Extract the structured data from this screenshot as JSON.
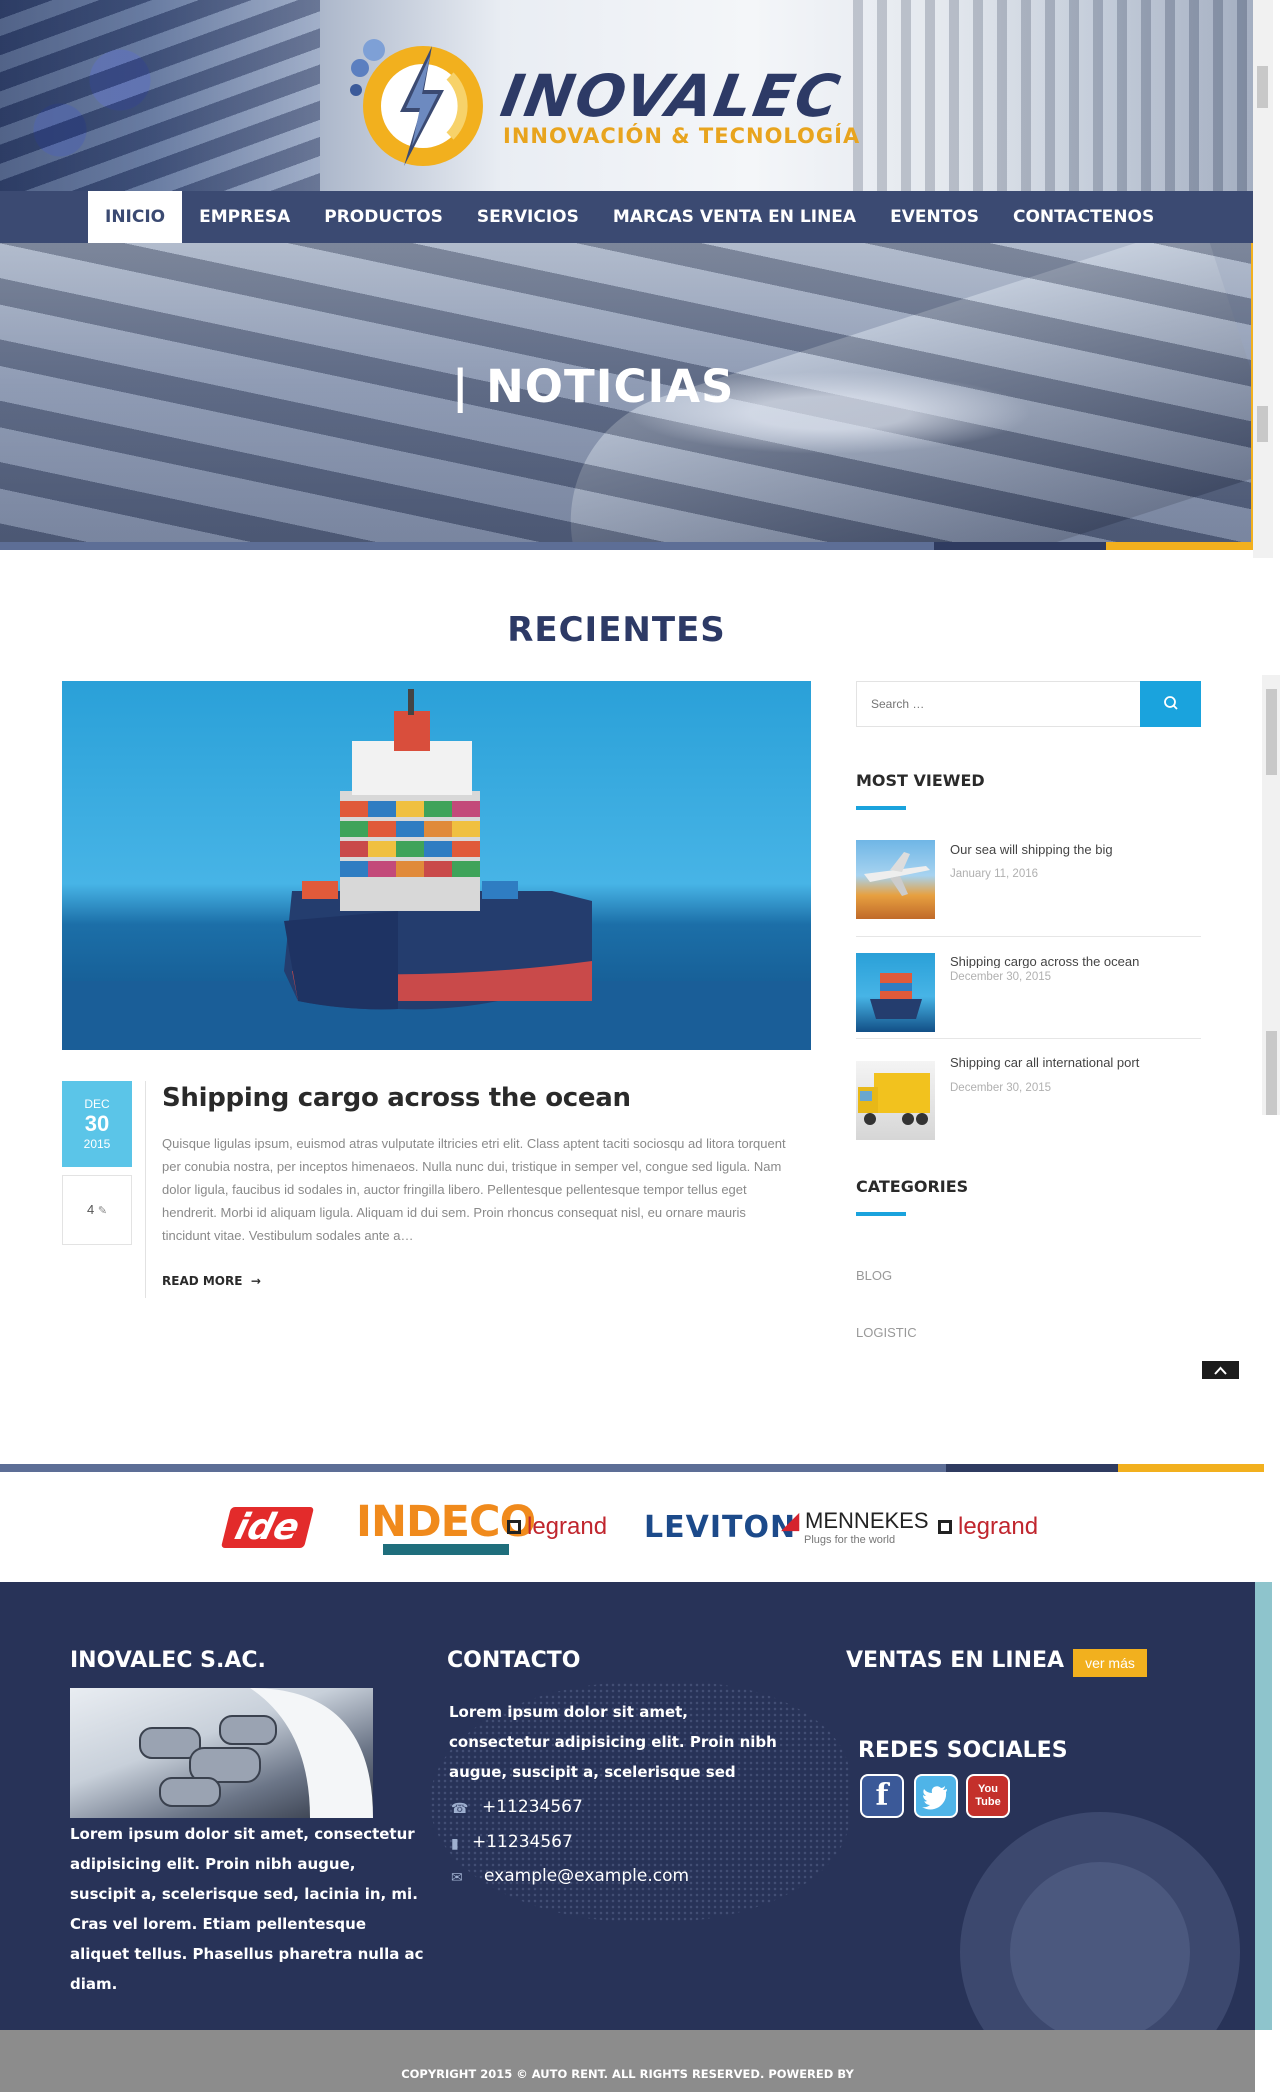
{
  "header": {
    "logo_name": "INOVALEC",
    "logo_tagline": "INNOVACIÓN & TECNOLOGÍA"
  },
  "nav": {
    "items": [
      "INICIO",
      "EMPRESA",
      "PRODUCTOS",
      "SERVICIOS",
      "MARCAS VENTA EN LINEA",
      "EVENTOS",
      "CONTACTENOS"
    ],
    "active": "INICIO"
  },
  "hero": {
    "title": "| NOTICIAS"
  },
  "main": {
    "section_title": "RECIENTES",
    "post": {
      "date_month": "DEC",
      "date_day": "30",
      "date_year": "2015",
      "comments": "4",
      "title": "Shipping cargo across the ocean",
      "excerpt": "Quisque ligulas ipsum, euismod atras vulputate iltricies etri elit. Class aptent taciti sociosqu ad litora torquent per conubia nostra, per inceptos himenaeos. Nulla nunc dui, tristique in semper vel, congue sed ligula. Nam dolor ligula, faucibus id sodales in, auctor fringilla libero. Pellentesque pellentesque tempor tellus eget hendrerit. Morbi id aliquam ligula. Aliquam id dui sem. Proin rhoncus consequat nisl, eu ornare mauris tincidunt vitae. Vestibulum sodales ante a…",
      "read_more": "READ MORE"
    }
  },
  "sidebar": {
    "search_placeholder": "Search …",
    "most_viewed_title": "MOST VIEWED",
    "most_viewed": [
      {
        "title": "Our sea will shipping the big",
        "date": "January 11, 2016"
      },
      {
        "title": "Shipping cargo across the ocean",
        "date": "December 30, 2015"
      },
      {
        "title": "Shipping car all international port",
        "date": "December 30, 2015"
      }
    ],
    "categories_title": "CATEGORIES",
    "categories": [
      "BLOG",
      "LOGISTIC"
    ]
  },
  "brands": {
    "items": [
      "ide",
      "INDECO",
      "legrand",
      "LEVITON",
      "MENNEKES",
      "legrand"
    ],
    "mennekes_tagline": "Plugs for the world"
  },
  "footer": {
    "col1_title": "INOVALEC S.AC.",
    "col1_text": "Lorem ipsum dolor sit amet, consectetur adipisicing elit. Proin nibh augue, suscipit a, scelerisque sed, lacinia in, mi. Cras vel lorem. Etiam pellentesque aliquet tellus. Phasellus pharetra nulla ac diam.",
    "col2_title": "CONTACTO",
    "col2_text": "Lorem ipsum dolor sit amet, consectetur adipisicing elit. Proin nibh augue, suscipit a, scelerisque sed",
    "phone1": "+11234567",
    "phone2": "+11234567",
    "email": "example@example.com",
    "col3_title": "VENTAS EN LINEA",
    "ver_mas": "ver más",
    "social_title": "REDES SOCIALES",
    "social": [
      "facebook",
      "twitter",
      "youtube"
    ],
    "youtube_label": "You Tube",
    "copyright": "COPYRIGHT 2015 © AUTO RENT. ALL RIGHTS RESERVED.  POWERED BY"
  },
  "colors": {
    "nav_bg": "#3b4a72",
    "accent_blue": "#1aa3dd",
    "accent_orange": "#f2b01e",
    "date_badge": "#5bc5e8",
    "footer_bg": "#283358"
  }
}
